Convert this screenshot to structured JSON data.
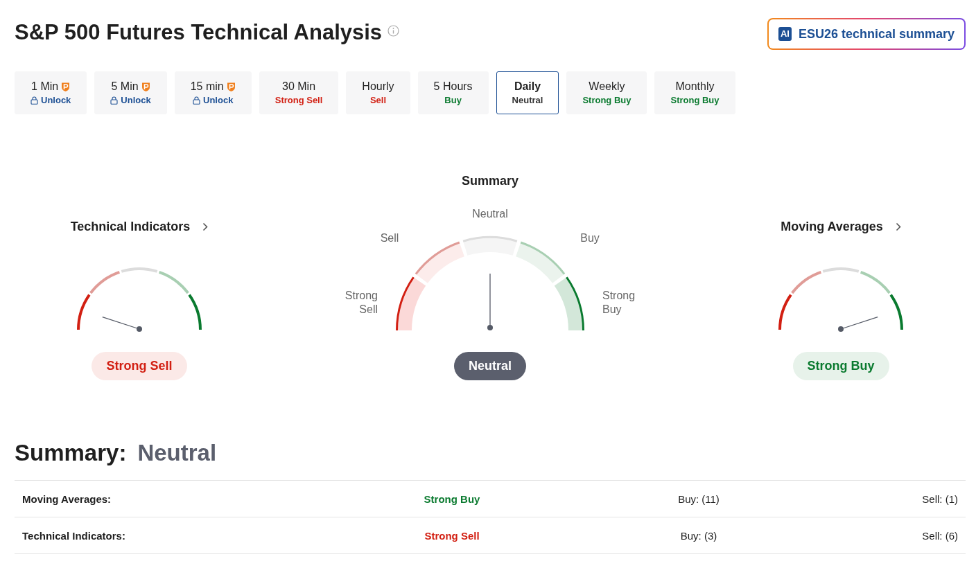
{
  "title": "S&P 500 Futures Technical Analysis",
  "ai_button": {
    "badge": "AI",
    "label": "ESU26 technical summary"
  },
  "timeframes": [
    {
      "label": "1 Min",
      "status": "Unlock",
      "locked": true,
      "selected": false
    },
    {
      "label": "5 Min",
      "status": "Unlock",
      "locked": true,
      "selected": false
    },
    {
      "label": "15 min",
      "status": "Unlock",
      "locked": true,
      "selected": false
    },
    {
      "label": "30 Min",
      "status": "Strong Sell",
      "color": "#d21f12",
      "locked": false,
      "selected": false
    },
    {
      "label": "Hourly",
      "status": "Sell",
      "color": "#d21f12",
      "locked": false,
      "selected": false
    },
    {
      "label": "5 Hours",
      "status": "Buy",
      "color": "#0a7a2f",
      "locked": false,
      "selected": false
    },
    {
      "label": "Daily",
      "status": "Neutral",
      "color": "#333333",
      "locked": false,
      "selected": true
    },
    {
      "label": "Weekly",
      "status": "Strong Buy",
      "color": "#0a7a2f",
      "locked": false,
      "selected": false
    },
    {
      "label": "Monthly",
      "status": "Strong Buy",
      "color": "#0a7a2f",
      "locked": false,
      "selected": false
    }
  ],
  "gauges": [
    {
      "kind": "small",
      "title": "Technical Indicators",
      "color": "#d21f12",
      "verdict": "Strong Sell"
    },
    {
      "kind": "large",
      "title": "Summary",
      "color": "#5b5f6d",
      "verdict": "Neutral",
      "scale_labels": [
        "Strong Sell",
        "Sell",
        "Neutral",
        "Buy",
        "Strong Buy"
      ]
    },
    {
      "kind": "small",
      "title": "Moving Averages",
      "color": "#0a7a2f",
      "verdict": "Strong Buy"
    }
  ],
  "summary": {
    "label": "Summary:",
    "value": "Neutral",
    "color": "#5b5f6d"
  },
  "rows": [
    {
      "name": "Moving Averages:",
      "verdict": "Strong Buy",
      "color": "#0a7a2f",
      "buy": "Buy: (11)",
      "sell": "Sell: (1)"
    },
    {
      "name": "Technical Indicators:",
      "verdict": "Strong Sell",
      "color": "#d21f12",
      "buy": "Buy: (3)",
      "sell": "Sell: (6)"
    }
  ]
}
